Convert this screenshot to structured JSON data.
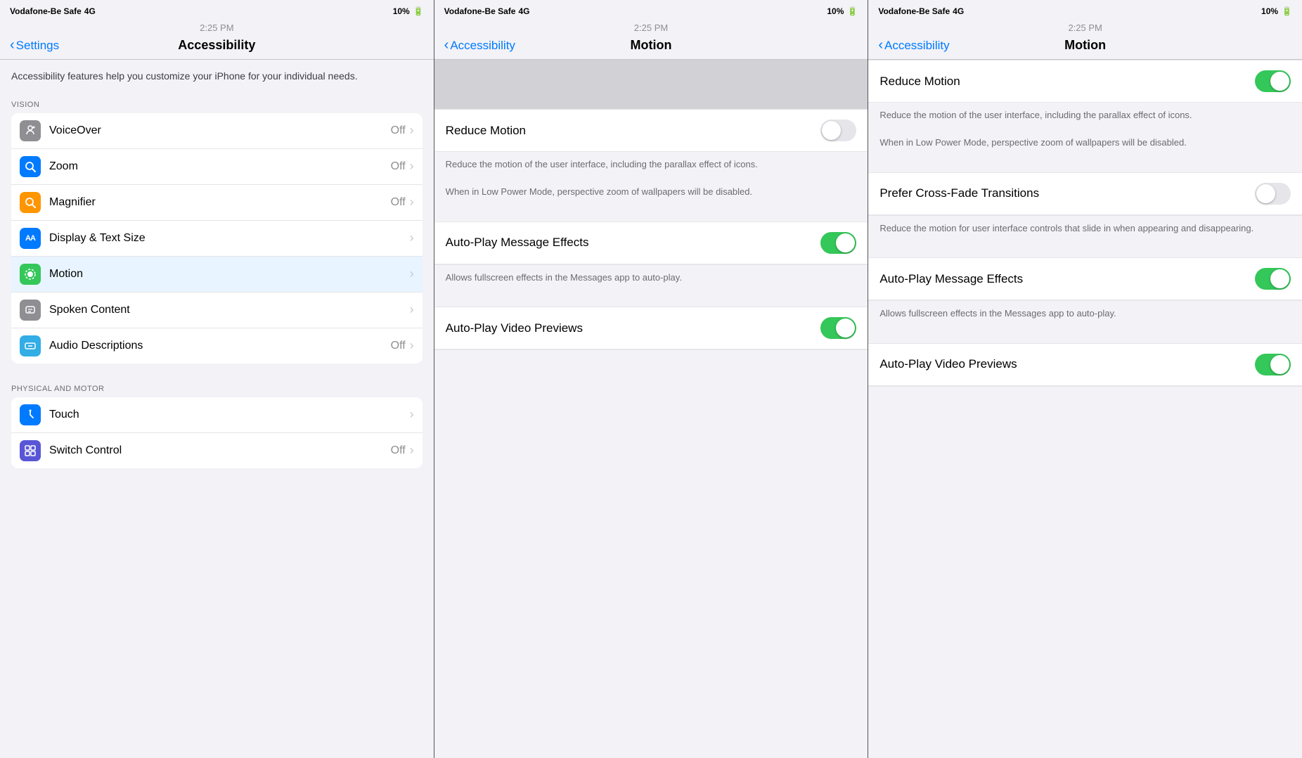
{
  "panels": [
    {
      "id": "accessibility-list",
      "statusBar": {
        "carrier": "Vodafone-Be Safe",
        "network": "4G",
        "time": "2:25 PM",
        "battery": "10%",
        "charging": true
      },
      "navBack": "Settings",
      "navTitle": "Accessibility",
      "introText": "Accessibility features help you customize your iPhone for your individual needs.",
      "sections": [
        {
          "header": "VISION",
          "items": [
            {
              "icon": "🔊",
              "iconBg": "bg-gray",
              "label": "VoiceOver",
              "value": "Off",
              "hasChevron": true
            },
            {
              "icon": "🔍",
              "iconBg": "bg-blue",
              "label": "Zoom",
              "value": "Off",
              "hasChevron": true
            },
            {
              "icon": "🔎",
              "iconBg": "bg-yellow",
              "label": "Magnifier",
              "value": "Off",
              "hasChevron": true
            },
            {
              "icon": "AA",
              "iconBg": "bg-blue",
              "label": "Display & Text Size",
              "value": "",
              "hasChevron": true
            },
            {
              "icon": "●",
              "iconBg": "bg-green",
              "label": "Motion",
              "value": "",
              "hasChevron": true,
              "active": true
            },
            {
              "icon": "💬",
              "iconBg": "bg-gray",
              "label": "Spoken Content",
              "value": "",
              "hasChevron": true
            },
            {
              "icon": "💬",
              "iconBg": "bg-cyan",
              "label": "Audio Descriptions",
              "value": "Off",
              "hasChevron": true
            }
          ]
        },
        {
          "header": "PHYSICAL AND MOTOR",
          "items": [
            {
              "icon": "✋",
              "iconBg": "bg-blue",
              "label": "Touch",
              "value": "",
              "hasChevron": true
            },
            {
              "icon": "⊞",
              "iconBg": "bg-indigo",
              "label": "Switch Control",
              "value": "Off",
              "hasChevron": true
            }
          ]
        }
      ]
    },
    {
      "id": "motion-off",
      "statusBar": {
        "carrier": "Vodafone-Be Safe",
        "network": "4G",
        "time": "2:25 PM",
        "battery": "10%",
        "charging": true
      },
      "navBack": "Accessibility",
      "navTitle": "Motion",
      "hasGrayBar": true,
      "settings": [
        {
          "label": "Reduce Motion",
          "toggleOn": false,
          "description": "Reduce the motion of the user interface, including the parallax effect of icons.\n\nWhen in Low Power Mode, perspective zoom of wallpapers will be disabled."
        },
        {
          "label": "Auto-Play Message Effects",
          "toggleOn": true,
          "description": "Allows fullscreen effects in the Messages app to auto-play."
        },
        {
          "label": "Auto-Play Video Previews",
          "toggleOn": true,
          "description": ""
        }
      ]
    },
    {
      "id": "motion-on",
      "statusBar": {
        "carrier": "Vodafone-Be Safe",
        "network": "4G",
        "time": "2:25 PM",
        "battery": "10%",
        "charging": true
      },
      "navBack": "Accessibility",
      "navTitle": "Motion",
      "settings": [
        {
          "label": "Reduce Motion",
          "toggleOn": true,
          "description": "Reduce the motion of the user interface, including the parallax effect of icons.\n\nWhen in Low Power Mode, perspective zoom of wallpapers will be disabled."
        },
        {
          "label": "Prefer Cross-Fade Transitions",
          "toggleOn": false,
          "description": "Reduce the motion for user interface controls that slide in when appearing and disappearing."
        },
        {
          "label": "Auto-Play Message Effects",
          "toggleOn": true,
          "description": "Allows fullscreen effects in the Messages app to auto-play."
        },
        {
          "label": "Auto-Play Video Previews",
          "toggleOn": true,
          "description": ""
        }
      ]
    }
  ]
}
